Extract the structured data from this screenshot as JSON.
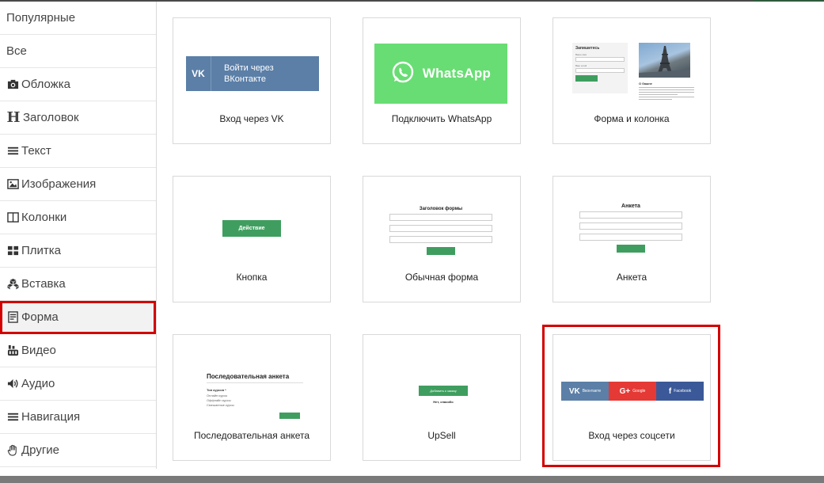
{
  "sidebar": {
    "items": [
      {
        "label": "Популярные",
        "icon": ""
      },
      {
        "label": "Все",
        "icon": ""
      },
      {
        "label": "Обложка",
        "icon": "camera-icon"
      },
      {
        "label": "Заголовок",
        "icon": "heading-icon",
        "glyph": "H"
      },
      {
        "label": "Текст",
        "icon": "text-lines-icon"
      },
      {
        "label": "Изображения",
        "icon": "image-icon"
      },
      {
        "label": "Колонки",
        "icon": "columns-icon"
      },
      {
        "label": "Плитка",
        "icon": "tiles-icon"
      },
      {
        "label": "Вставка",
        "icon": "cubes-icon"
      },
      {
        "label": "Форма",
        "icon": "form-icon",
        "selected": true
      },
      {
        "label": "Видео",
        "icon": "youtube-icon"
      },
      {
        "label": "Аудио",
        "icon": "volume-icon"
      },
      {
        "label": "Навигация",
        "icon": "menu-icon"
      },
      {
        "label": "Другие",
        "icon": "hand-icon"
      }
    ]
  },
  "cards": [
    {
      "label": "Вход через VK",
      "preview": {
        "vk_logo": "VK",
        "button_text": "Войти через ВКонтакте"
      }
    },
    {
      "label": "Подключить WhatsApp",
      "preview": {
        "button_text": "WhatsApp"
      }
    },
    {
      "label": "Форма и колонка",
      "preview": {
        "form_title": "Запишитесь",
        "field1_label": "Ваше имя",
        "field2_label": "Ваш email",
        "text_title": "О башне"
      }
    },
    {
      "label": "Кнопка",
      "preview": {
        "button_text": "Действие"
      }
    },
    {
      "label": "Обычная форма",
      "preview": {
        "title": "Заголовок формы"
      }
    },
    {
      "label": "Анкета",
      "preview": {
        "title": "Анкета"
      }
    },
    {
      "label": "Последовательная анкета",
      "preview": {
        "title": "Последовательная анкета",
        "question": "Тип курсов *",
        "options": [
          "Онлайн курсы",
          "Оффлайн курсы",
          "Смешанные курсы"
        ]
      }
    },
    {
      "label": "UpSell",
      "preview": {
        "button_text": "Добавить к заказу",
        "decline_text": "Нет, спасибо"
      }
    },
    {
      "label": "Вход через соцсети",
      "preview": {
        "vk_label": "Вконтакте",
        "google_label": "Google",
        "facebook_label": "Facebook",
        "highlighted": true
      }
    }
  ],
  "colors": {
    "accent_green": "#3f9e5f",
    "vk_blue": "#5b7fa7",
    "whatsapp_green": "#68dd73",
    "google_red": "#e53935",
    "facebook_blue": "#3b5998",
    "highlight_red": "#d40000"
  }
}
